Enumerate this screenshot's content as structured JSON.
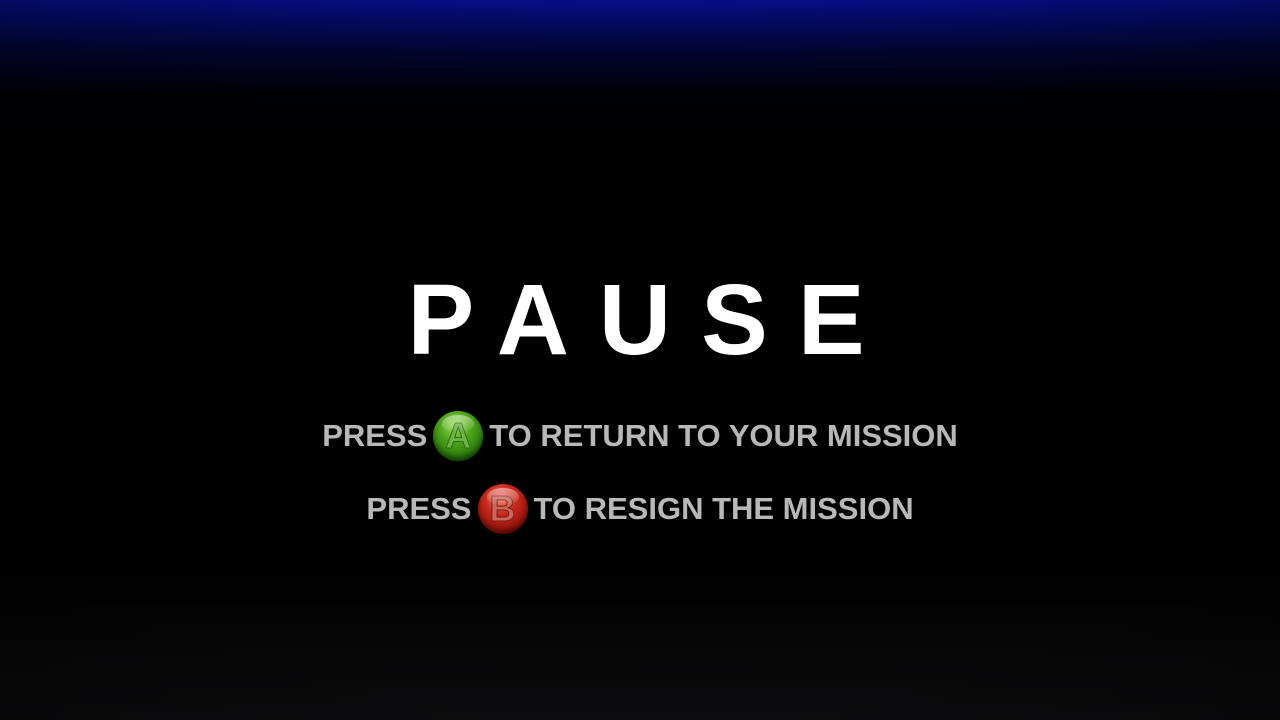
{
  "pause_screen": {
    "title": "PAUSE",
    "options": [
      {
        "prefix": "PRESS",
        "button": "A",
        "button_color": "#3e9417",
        "suffix": "TO RETURN TO YOUR MISSION"
      },
      {
        "prefix": "PRESS",
        "button": "B",
        "button_color": "#b51f14",
        "suffix": "TO RESIGN THE MISSION"
      }
    ]
  },
  "colors": {
    "background_top": "#05119a",
    "background": "#000000",
    "title": "#ffffff",
    "prompt_text": "#b8b8b8"
  }
}
